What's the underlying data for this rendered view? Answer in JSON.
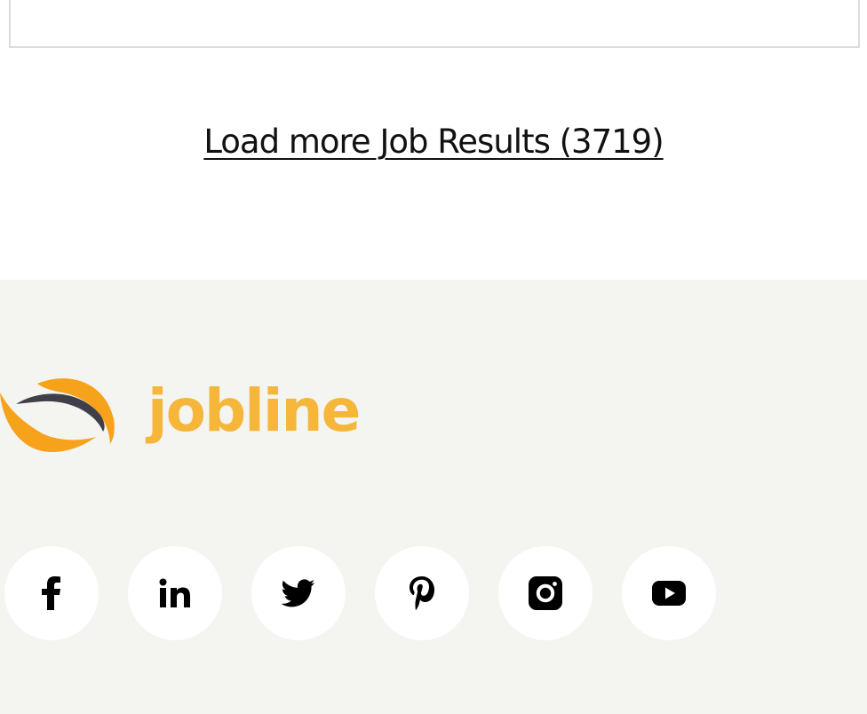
{
  "load_more": {
    "label": "Load more Job Results (3719)"
  },
  "footer": {
    "logo": {
      "text": "jobline",
      "colors": {
        "text": "#f5b63a",
        "swoosh_orange": "#f7a21b",
        "swoosh_dark": "#3f3f4a"
      }
    },
    "social": [
      {
        "name": "facebook",
        "icon": "facebook-icon"
      },
      {
        "name": "linkedin",
        "icon": "linkedin-icon"
      },
      {
        "name": "twitter",
        "icon": "twitter-icon"
      },
      {
        "name": "pinterest",
        "icon": "pinterest-icon"
      },
      {
        "name": "instagram",
        "icon": "instagram-icon"
      },
      {
        "name": "youtube",
        "icon": "youtube-icon"
      }
    ]
  },
  "colors": {
    "footer_background": "#f4f4f1",
    "icon_circle": "#ffffff",
    "icon_glyph": "#000000"
  }
}
